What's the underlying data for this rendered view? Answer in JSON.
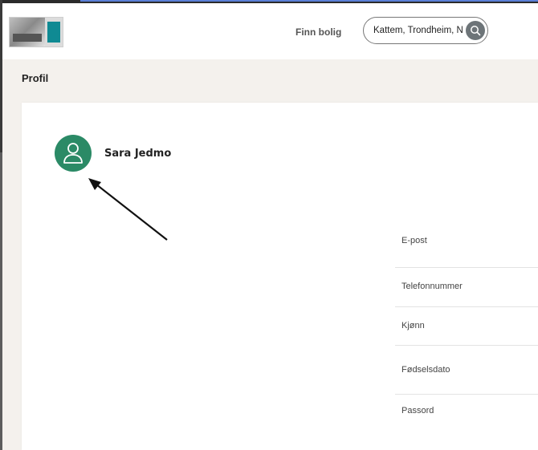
{
  "header": {
    "logo_alt": "logo",
    "nav_link": "Finn bolig",
    "search": {
      "value": "Kattem, Trondheim, N",
      "icon": "search-icon"
    }
  },
  "page": {
    "title": "Profil"
  },
  "profile": {
    "avatar_icon": "user-icon",
    "avatar_color": "#2b8a66",
    "name": "Sara Jedmo"
  },
  "fields": [
    {
      "label": "E-post"
    },
    {
      "label": "Telefonnummer"
    },
    {
      "label": "Kjønn"
    },
    {
      "label": "Fødselsdato"
    },
    {
      "label": "Passord"
    }
  ],
  "annotation": {
    "arrow_icon": "arrow-annotation",
    "color": "#111111"
  }
}
